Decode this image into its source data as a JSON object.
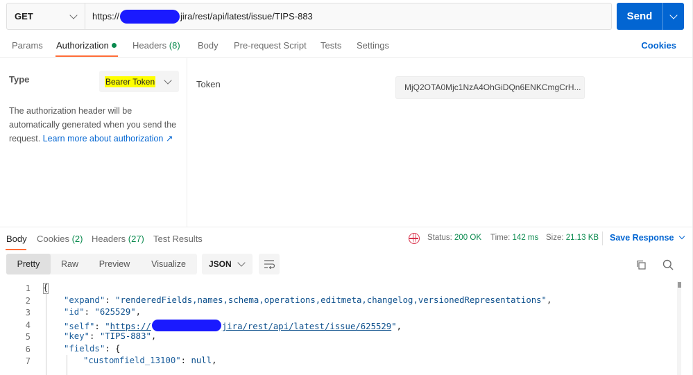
{
  "request": {
    "method": "GET",
    "url_prefix": "https://",
    "url_suffix": "jira/rest/api/latest/issue/TIPS-883",
    "send_label": "Send"
  },
  "request_tabs": {
    "params": "Params",
    "authorization": "Authorization",
    "headers": "Headers",
    "headers_count": "(8)",
    "body": "Body",
    "pre_request": "Pre-request Script",
    "tests": "Tests",
    "settings": "Settings",
    "cookies": "Cookies"
  },
  "auth": {
    "type_label": "Type",
    "type_value": "Bearer Token",
    "description": "The authorization header will be automatically generated when you send the request.",
    "learn_more": "Learn more about authorization ↗",
    "token_label": "Token",
    "token_value": "MjQ2OTA0Mjc1NzA4OhGiDQn6ENKCmgCrH..."
  },
  "response_tabs": {
    "body": "Body",
    "cookies": "Cookies",
    "cookies_count": "(2)",
    "headers": "Headers",
    "headers_count": "(27)",
    "test_results": "Test Results"
  },
  "status": {
    "status_label": "Status:",
    "status_value": "200 OK",
    "time_label": "Time:",
    "time_value": "142 ms",
    "size_label": "Size:",
    "size_value": "21.13 KB",
    "save_response": "Save Response"
  },
  "format_toolbar": {
    "pretty": "Pretty",
    "raw": "Raw",
    "preview": "Preview",
    "visualize": "Visualize",
    "json_label": "JSON"
  },
  "code": {
    "line_numbers": [
      "1",
      "2",
      "3",
      "4",
      "5",
      "6",
      "7"
    ],
    "l1": "{",
    "l2_key": "\"expand\"",
    "l2_val": "\"renderedFields,names,schema,operations,editmeta,changelog,versionedRepresentations\"",
    "l3_key": "\"id\"",
    "l3_val": "\"625529\"",
    "l4_key": "\"self\"",
    "l4_open": "\"",
    "l4_url_prefix": "https://",
    "l4_url_suffix": "jira/rest/api/latest/issue/625529",
    "l4_close": "\"",
    "l5_key": "\"key\"",
    "l5_val": "\"TIPS-883\"",
    "l6_key": "\"fields\"",
    "l6_val": "{",
    "l7_key": "\"customfield_13100\"",
    "l7_val": "null"
  },
  "colors": {
    "accent_orange": "#ff6c37",
    "primary_blue": "#0265d2",
    "success_green": "#0a8a4e",
    "highlight_yellow": "#ffff00",
    "redaction_blue": "#1a1aff"
  }
}
